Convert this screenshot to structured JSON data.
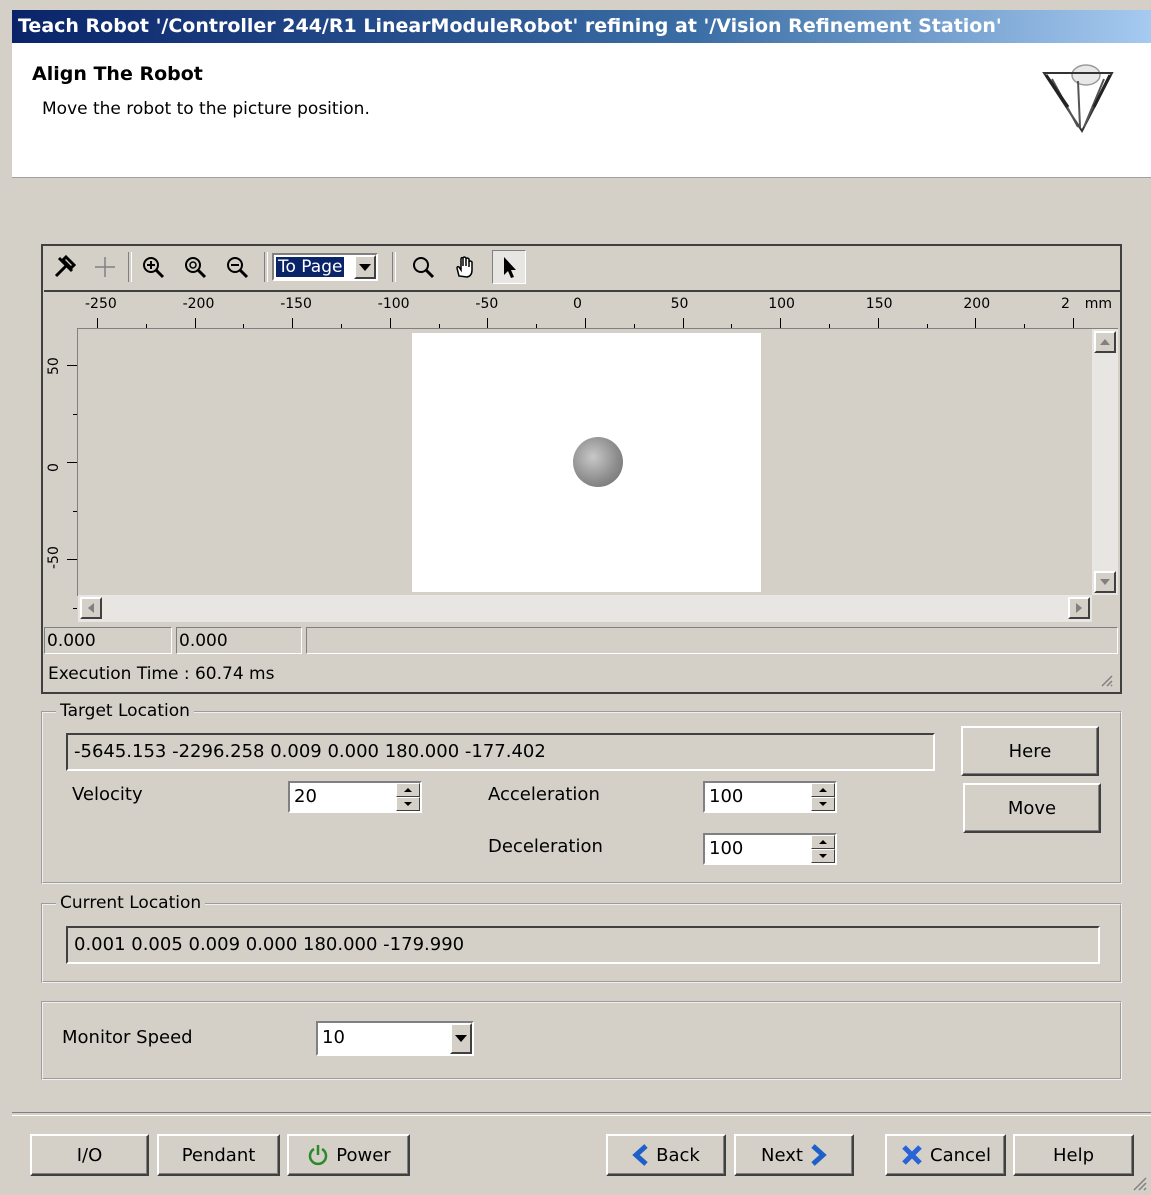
{
  "window": {
    "title": "Teach Robot '/Controller 244/R1 LinearModuleRobot' refining at '/Vision Refinement Station'"
  },
  "header": {
    "title": "Align The Robot",
    "subtitle": "Move the robot to the picture position.",
    "logo_icon": "delta-robot-icon"
  },
  "viewer": {
    "toolbar": {
      "zoom_value": "To Page",
      "icons": [
        "tools-icon",
        "crosshair-icon",
        "zoom-in-icon",
        "zoom-fit-icon",
        "zoom-out-icon",
        "magnifier-icon",
        "pan-hand-icon",
        "pointer-arrow-icon"
      ]
    },
    "hruler": {
      "ticks": [
        "-250",
        "-200",
        "-150",
        "-100",
        "-50",
        "0",
        "50",
        "100",
        "150",
        "200",
        "2"
      ],
      "unit": "mm"
    },
    "vruler": {
      "ticks": [
        "50",
        "0",
        "-50"
      ]
    },
    "status": {
      "x_value": "0.000",
      "y_value": "0.000",
      "execution_time": "Execution Time : 60.74 ms"
    }
  },
  "target": {
    "legend": "Target Location",
    "value": "-5645.153 -2296.258 0.009 0.000 180.000 -177.402",
    "velocity_label": "Velocity",
    "velocity_value": "20",
    "acceleration_label": "Acceleration",
    "acceleration_value": "100",
    "deceleration_label": "Deceleration",
    "deceleration_value": "100",
    "here_label": "Here",
    "move_label": "Move"
  },
  "current": {
    "legend": "Current Location",
    "value": "0.001 0.005 0.009 0.000 180.000 -179.990"
  },
  "monitor": {
    "label": "Monitor Speed",
    "value": "10"
  },
  "footer": {
    "io_label": "I/O",
    "pendant_label": "Pendant",
    "power_label": "Power",
    "back_label": "Back",
    "next_label": "Next",
    "cancel_label": "Cancel",
    "help_label": "Help"
  },
  "colors": {
    "titlebar_start": "#0a246a",
    "face": "#d4d0c8",
    "next_arrow": "#1f5fc8",
    "cancel_x": "#2a63d8",
    "power_icon": "#2a8a2a"
  }
}
